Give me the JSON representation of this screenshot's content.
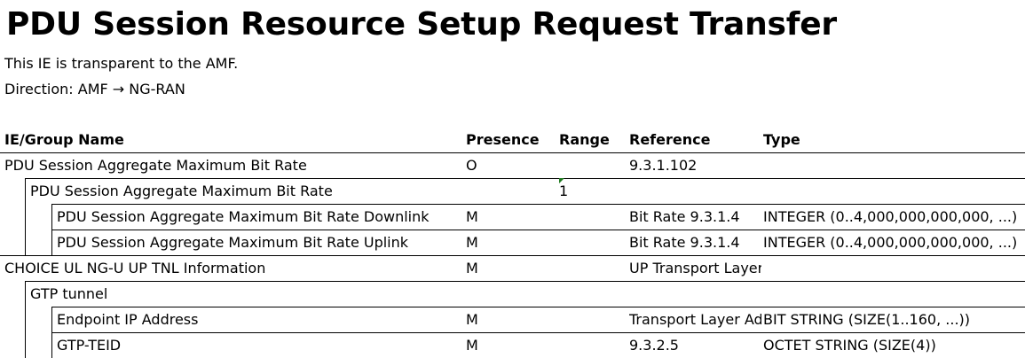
{
  "document": {
    "title": "PDU Session Resource Setup Request Transfer",
    "description": "This IE is transparent to the AMF.",
    "direction": "Direction: AMF → NG-RAN"
  },
  "table": {
    "headers": {
      "name": "IE/Group Name",
      "presence": "Presence",
      "range": "Range",
      "reference": "Reference",
      "type": "Type"
    },
    "rows": [
      {
        "name": "PDU Session Aggregate Maximum Bit Rate",
        "presence": "O",
        "range": "",
        "reference": "9.3.1.102",
        "type": ""
      },
      {
        "name": "PDU Session Aggregate Maximum Bit Rate",
        "presence": "",
        "range": "1",
        "reference": "",
        "type": ""
      },
      {
        "name": "PDU Session Aggregate Maximum Bit Rate Downlink",
        "presence": "M",
        "range": "",
        "reference": "Bit Rate 9.3.1.4",
        "type": "INTEGER (0..4,000,000,000,000, ...)"
      },
      {
        "name": "PDU Session Aggregate Maximum Bit Rate Uplink",
        "presence": "M",
        "range": "",
        "reference": "Bit Rate 9.3.1.4",
        "type": "INTEGER (0..4,000,000,000,000, ...)"
      },
      {
        "name": "CHOICE UL NG-U UP TNL Information",
        "presence": "M",
        "range": "",
        "reference": "UP Transport Layer Information",
        "type": ""
      },
      {
        "name": "GTP tunnel",
        "presence": "",
        "range": "",
        "reference": "",
        "type": ""
      },
      {
        "name": "Endpoint IP Address",
        "presence": "M",
        "range": "",
        "reference": "Transport Layer Address",
        "type": "BIT STRING (SIZE(1..160, ...))"
      },
      {
        "name": "GTP-TEID",
        "presence": "M",
        "range": "",
        "reference": "9.3.2.5",
        "type": "OCTET STRING (SIZE(4))"
      }
    ]
  }
}
